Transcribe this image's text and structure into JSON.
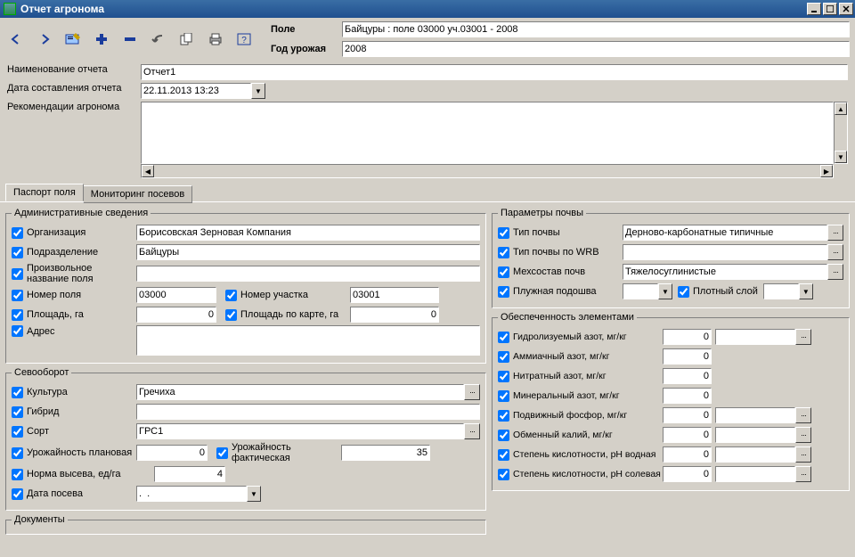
{
  "window": {
    "title": "Отчет агронома"
  },
  "toolbar": {
    "icons": {
      "prev": "arrow-left",
      "next": "arrow-right",
      "edit": "edit",
      "add": "plus",
      "remove": "minus",
      "undo": "undo",
      "copy": "copy",
      "print": "print",
      "help": "help"
    }
  },
  "header": {
    "labels": {
      "field": "Поле",
      "harvest_year": "Год урожая"
    },
    "field_value": "Байцуры : поле 03000 уч.03001 - 2008",
    "harvest_year_value": "2008"
  },
  "top_fields": {
    "labels": {
      "report_name": "Наименование отчета",
      "report_date": "Дата составления отчета",
      "recommendations": "Рекомендации агронома"
    },
    "report_name_value": "Отчет1",
    "report_date_value": "22.11.2013 13:23",
    "recommendations_value": ""
  },
  "tabs": {
    "t1": "Паспорт поля",
    "t2": "Мониторинг посевов"
  },
  "admin": {
    "legend": "Административные сведения",
    "labels": {
      "org": "Организация",
      "dept": "Подразделение",
      "arbitrary_name": "Произвольное название поля",
      "field_no": "Номер поля",
      "plot_no": "Номер участка",
      "area": "Площадь, га",
      "area_map": "Площадь по карте, га",
      "address": "Адрес"
    },
    "org": "Борисовская Зерновая Компания",
    "dept": "Байцуры",
    "arbitrary_name": "",
    "field_no": "03000",
    "plot_no": "03001",
    "area": "0",
    "area_map": "0",
    "address": ""
  },
  "rotation": {
    "legend": "Севооборот",
    "labels": {
      "culture": "Культура",
      "hybrid": "Гибрид",
      "sort": "Сорт",
      "yield_plan": "Урожайность плановая",
      "yield_fact": "Урожайность фактическая",
      "seed_rate": "Норма высева, ед/га",
      "sow_date": "Дата посева"
    },
    "culture": "Гречиха",
    "hybrid": "",
    "sort": "ГРС1",
    "yield_plan": "0",
    "yield_fact": "35",
    "seed_rate": "4",
    "sow_date": ".  ."
  },
  "docs": {
    "legend": "Документы"
  },
  "soil": {
    "legend": "Параметры почвы",
    "labels": {
      "type": "Тип почвы",
      "wrb": "Тип почвы по WRB",
      "texture": "Мехсостав почв",
      "hardpan": "Плужная подошва",
      "dense_layer": "Плотный слой"
    },
    "type": "Дерново-карбонатные типичные",
    "wrb": "",
    "texture": "Тяжелосуглинистые",
    "hardpan": "",
    "dense_layer": ""
  },
  "elements": {
    "legend": "Обеспеченность элементами",
    "items": [
      {
        "label": "Гидролизуемый азот, мг/кг",
        "value": "0",
        "code": "",
        "has_code": true
      },
      {
        "label": "Аммиачный азот, мг/кг",
        "value": "0",
        "has_code": false
      },
      {
        "label": "Нитратный азот, мг/кг",
        "value": "0",
        "has_code": false
      },
      {
        "label": "Минеральный азот, мг/кг",
        "value": "0",
        "has_code": false
      },
      {
        "label": "Подвижный фосфор, мг/кг",
        "value": "0",
        "code": "",
        "has_code": true
      },
      {
        "label": "Обменный калий, мг/кг",
        "value": "0",
        "code": "",
        "has_code": true
      },
      {
        "label": "Степень кислотности, рН водная",
        "value": "0",
        "code": "",
        "has_code": true
      },
      {
        "label": "Степень кислотности, рН солевая",
        "value": "0",
        "code": "",
        "has_code": true
      }
    ]
  }
}
